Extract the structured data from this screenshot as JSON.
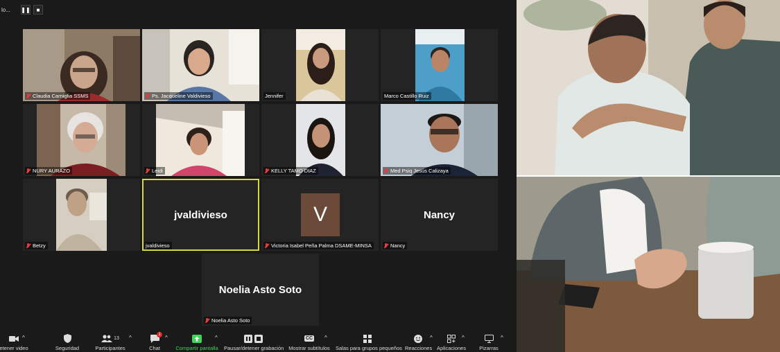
{
  "recording": {
    "text": "lo...",
    "pause_icon": "pause-icon",
    "stop_icon": "stop-icon"
  },
  "participants": [
    {
      "name": "Claudia Carniglia SSMS",
      "mic": "muted",
      "type": "video",
      "colors": [
        "#8d7a65",
        "#c9b49a",
        "#3a2a22"
      ]
    },
    {
      "name": "Ps. Jacqueline Valdivieso",
      "mic": "muted",
      "type": "video",
      "colors": [
        "#e6e2d8",
        "#5877a6",
        "#2b2421"
      ]
    },
    {
      "name": "Jennifer",
      "mic": "on",
      "type": "video",
      "colors": [
        "#d9c79b",
        "#f2ece2",
        "#2b1d17"
      ]
    },
    {
      "name": "Marco Castillo Ruiz",
      "mic": "on",
      "type": "video",
      "colors": [
        "#4d9ec9",
        "#2f7aa3",
        "#2c2623"
      ]
    },
    {
      "name": "NURY AURAZO",
      "mic": "muted",
      "type": "video",
      "colors": [
        "#7c6450",
        "#c7b9a7",
        "#7a1e22"
      ]
    },
    {
      "name": "Leidi",
      "mic": "muted",
      "type": "video",
      "colors": [
        "#c5bdb2",
        "#efe9dd",
        "#d1456a"
      ]
    },
    {
      "name": "KELLY TAMO DIAZ",
      "mic": "muted",
      "type": "video",
      "colors": [
        "#cfd1d6",
        "#e4e5e9",
        "#1f2230"
      ]
    },
    {
      "name": "Med Psiq Jesús Calizaya",
      "mic": "muted",
      "type": "video",
      "colors": [
        "#c4ced6",
        "#9aa6ad",
        "#1a2436"
      ]
    },
    {
      "name": "Betzy",
      "mic": "muted",
      "type": "video",
      "colors": [
        "#d6cec1",
        "#bfb3a0",
        "#9a8b76"
      ]
    },
    {
      "name": "jvaldivieso",
      "mic": "on",
      "type": "name",
      "display": "jvaldivieso",
      "active": true
    },
    {
      "name": "Victoria Isabel Peña Palma DSAME-MINSA",
      "mic": "muted",
      "type": "avatar",
      "initial": "V",
      "avatar_color": "#6b4a3a"
    },
    {
      "name": "Nancy",
      "mic": "muted",
      "type": "name",
      "display": "Nancy"
    },
    {
      "name": "Noelia Asto Soto",
      "mic": "muted",
      "type": "name",
      "display": "Noelia Asto Soto"
    }
  ],
  "toolbar": {
    "video": {
      "label": "etener video",
      "icon": "video-camera-icon"
    },
    "security": {
      "label": "Seguridad",
      "icon": "shield-icon"
    },
    "participants": {
      "label": "Participantes",
      "icon": "people-icon",
      "count": "13"
    },
    "chat": {
      "label": "Chat",
      "icon": "chat-bubble-icon",
      "badge": "1"
    },
    "share": {
      "label": "Compartir pantalla",
      "icon": "share-screen-icon"
    },
    "record": {
      "label": "Pausar/detener grabación",
      "icon": "pause-stop-icon"
    },
    "captions": {
      "label": "Mostrar subtítulos",
      "icon": "cc-icon",
      "icon_text": "CC"
    },
    "breakout": {
      "label": "Salas para grupos pequeños",
      "icon": "breakout-rooms-icon"
    },
    "reactions": {
      "label": "Reacciones",
      "icon": "smile-icon"
    },
    "apps": {
      "label": "Aplicaciones",
      "icon": "apps-icon"
    },
    "whiteboard": {
      "label": "Pizarras",
      "icon": "whiteboard-icon"
    }
  },
  "photos": [
    {
      "name": "photo-comforting-shoulder",
      "colors": [
        "#c9bfae",
        "#e8e4dc",
        "#4a5a56",
        "#b98c6e"
      ]
    },
    {
      "name": "photo-holding-hands",
      "colors": [
        "#9e9b8e",
        "#7c5a3e",
        "#d9d8d4",
        "#5d6668"
      ]
    }
  ]
}
